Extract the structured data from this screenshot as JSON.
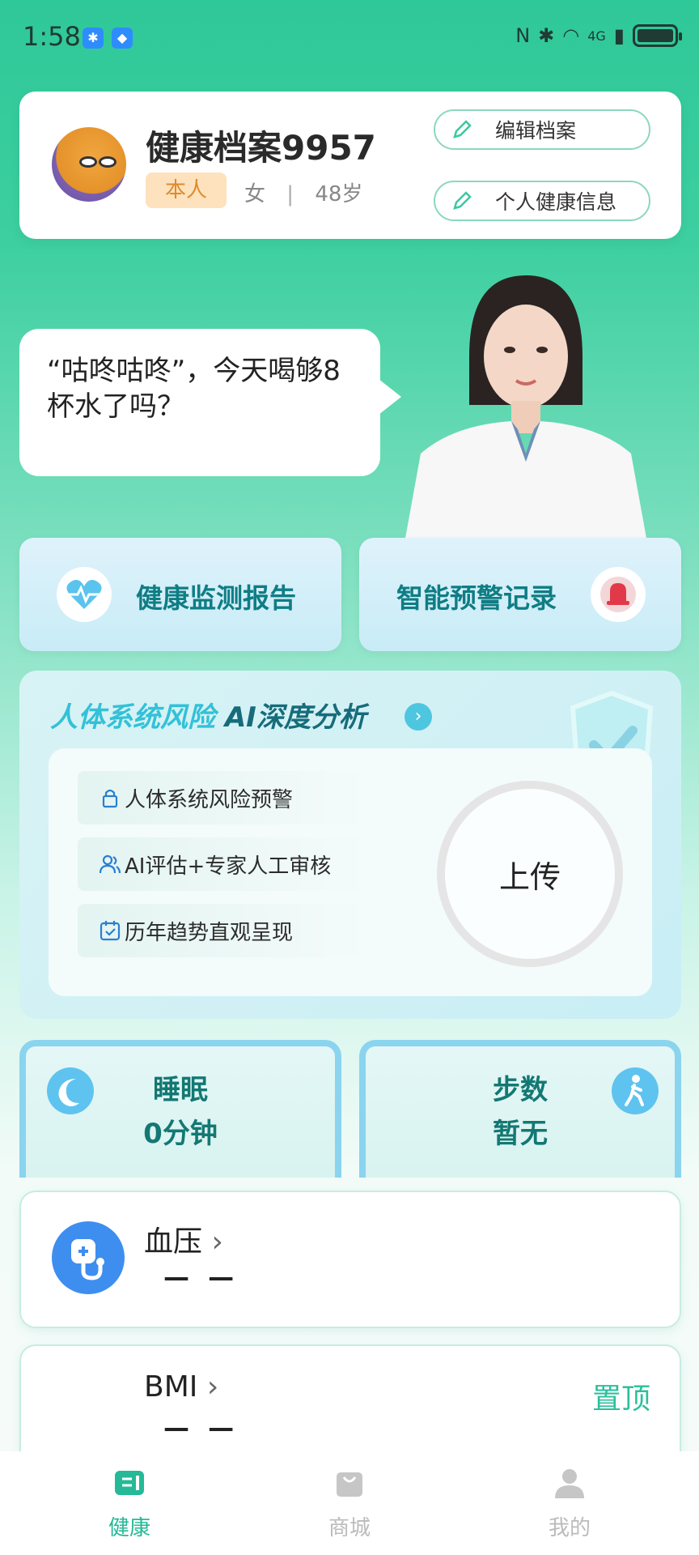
{
  "status_bar": {
    "time": "1:58",
    "network": "4G"
  },
  "profile": {
    "name": "健康档案9957",
    "relation_tag": "本人",
    "gender": "女",
    "separator": "|",
    "age": "48岁",
    "edit_button": "编辑档案",
    "info_button": "个人健康信息"
  },
  "assistant": {
    "bubble_text": "“咕咚咕咚”，今天喝够8杯水了吗？"
  },
  "quick_actions": {
    "report": "健康监测报告",
    "warning": "智能预警记录"
  },
  "ai_analysis": {
    "title_part1": "人体系统风险",
    "title_part2": " AI深度分析",
    "features": [
      "人体系统风险预警",
      "AI评估+专家人工审核",
      "历年趋势直观呈现"
    ],
    "upload_label": "上传"
  },
  "metrics": {
    "sleep_label": "睡眠",
    "sleep_value": "0分钟",
    "steps_label": "步数",
    "steps_value": "暂无"
  },
  "records": {
    "bp_title": "血压",
    "bp_value": "— —",
    "bmi_title": "BMI",
    "bmi_value": "— —",
    "pin_label": "置顶"
  },
  "tabs": [
    "健康",
    "商城",
    "我的"
  ],
  "colors": {
    "brand": "#25b997",
    "accent_teal": "#0f7d84",
    "bp_icon": "#3e8ef0"
  }
}
